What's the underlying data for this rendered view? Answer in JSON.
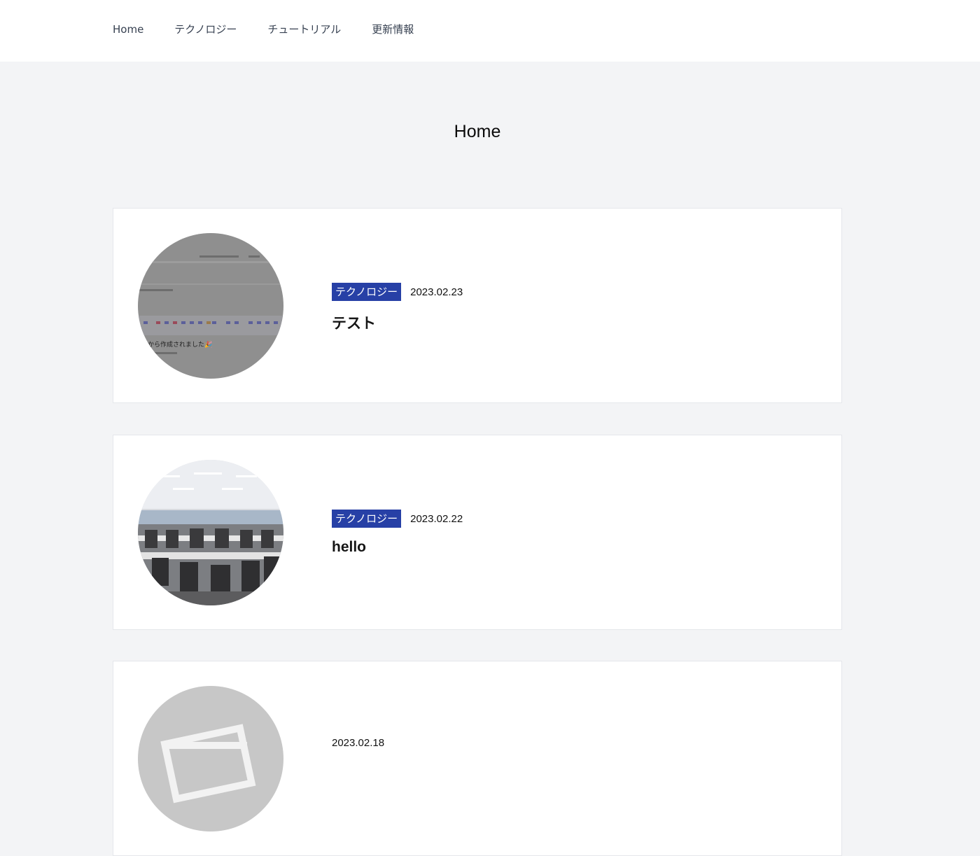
{
  "nav": {
    "items": [
      "Home",
      "テクノロジー",
      "チュートリアル",
      "更新情報"
    ]
  },
  "page": {
    "title": "Home"
  },
  "posts": [
    {
      "category": "テクノロジー",
      "date": "2023.02.23",
      "title": "テスト",
      "thumbnail_icon": "editor-screenshot-image",
      "thumb_text": "から作成されました🎉"
    },
    {
      "category": "テクノロジー",
      "date": "2023.02.22",
      "title": "hello",
      "thumbnail_icon": "office-photo-image"
    },
    {
      "category": "",
      "date": "2023.02.18",
      "title": "",
      "thumbnail_icon": "image-placeholder-icon"
    }
  ],
  "colors": {
    "badge": "#2740a6",
    "page_bg": "#f3f4f6",
    "card_bg": "#ffffff"
  }
}
